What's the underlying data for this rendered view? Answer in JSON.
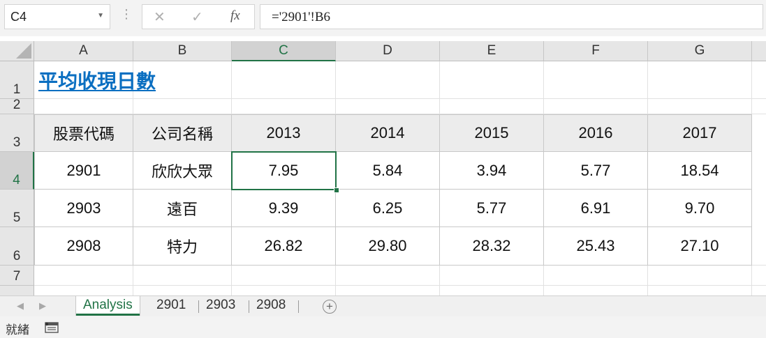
{
  "name_box": {
    "value": "C4"
  },
  "formula_bar": {
    "cancel_glyph": "✕",
    "enter_glyph": "✓",
    "fx_label": "fx",
    "formula": "='2901'!B6"
  },
  "columns": [
    "A",
    "B",
    "C",
    "D",
    "E",
    "F",
    "G"
  ],
  "rows": [
    "1",
    "2",
    "3",
    "4",
    "5",
    "6",
    "7"
  ],
  "selected_cell": "C4",
  "title": "平均收現日數",
  "table": {
    "headers": [
      "股票代碼",
      "公司名稱",
      "2013",
      "2014",
      "2015",
      "2016",
      "2017"
    ],
    "rows": [
      [
        "2901",
        "欣欣大眾",
        "7.95",
        "5.84",
        "3.94",
        "5.77",
        "18.54"
      ],
      [
        "2903",
        "遠百",
        "9.39",
        "6.25",
        "5.77",
        "6.91",
        "9.70"
      ],
      [
        "2908",
        "特力",
        "26.82",
        "29.80",
        "28.32",
        "25.43",
        "27.10"
      ]
    ]
  },
  "sheet_tabs": [
    "Analysis",
    "2901",
    "2903",
    "2908"
  ],
  "active_tab": "Analysis",
  "status": {
    "ready": "就緒"
  },
  "icons": [
    "dropdown-arrow-icon",
    "cancel-icon",
    "enter-icon",
    "function-icon",
    "select-all-icon",
    "prev-sheet-icon",
    "next-sheet-icon",
    "add-sheet-icon",
    "macro-record-icon"
  ]
}
